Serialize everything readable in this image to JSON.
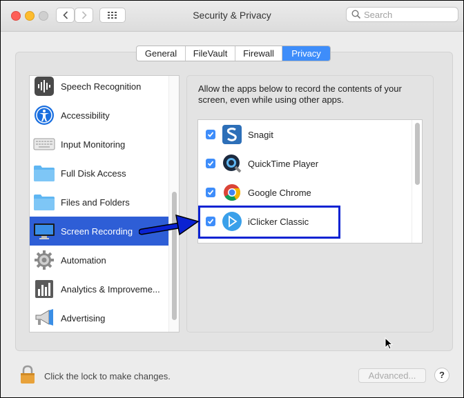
{
  "window": {
    "title": "Security & Privacy",
    "search_placeholder": "Search"
  },
  "tabs": [
    {
      "label": "General",
      "active": false
    },
    {
      "label": "FileVault",
      "active": false
    },
    {
      "label": "Firewall",
      "active": false
    },
    {
      "label": "Privacy",
      "active": true
    }
  ],
  "sidebar": {
    "items": [
      {
        "label": "Speech Recognition",
        "icon": "speech-recognition-icon"
      },
      {
        "label": "Accessibility",
        "icon": "accessibility-icon"
      },
      {
        "label": "Input Monitoring",
        "icon": "keyboard-icon"
      },
      {
        "label": "Full Disk Access",
        "icon": "folder-icon"
      },
      {
        "label": "Files and Folders",
        "icon": "folder-icon"
      },
      {
        "label": "Screen Recording",
        "icon": "display-icon",
        "selected": true
      },
      {
        "label": "Automation",
        "icon": "gear-icon"
      },
      {
        "label": "Analytics & Improveme...",
        "icon": "analytics-icon"
      },
      {
        "label": "Advertising",
        "icon": "megaphone-icon"
      }
    ]
  },
  "main": {
    "description": "Allow the apps below to record the contents of your screen, even while using other apps.",
    "apps": [
      {
        "name": "Snagit",
        "checked": true,
        "icon": "snagit-icon"
      },
      {
        "name": "QuickTime Player",
        "checked": true,
        "icon": "quicktime-icon"
      },
      {
        "name": "Google Chrome",
        "checked": true,
        "icon": "chrome-icon"
      },
      {
        "name": "iClicker Classic",
        "checked": true,
        "icon": "iclicker-icon"
      }
    ]
  },
  "footer": {
    "lock_text": "Click the lock to make changes.",
    "advanced_label": "Advanced...",
    "help_label": "?"
  },
  "colors": {
    "accent": "#3e8dfa",
    "selected_row": "#2e5ed6",
    "annotation": "#0a22d2"
  }
}
